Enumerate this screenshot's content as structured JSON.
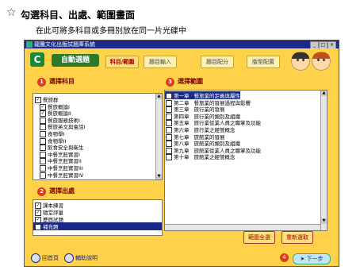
{
  "header": {
    "star": "☆",
    "title": "勾選科目、出處、範圍畫面",
    "subtitle": "在此可將多科目或多冊別放在同一片光碟中"
  },
  "window": {
    "title": "龍騰文化出版試題庫系統",
    "min_label": "_",
    "max_label": "□",
    "close_label": "×"
  },
  "toolbar": {
    "logo": "C",
    "brand": "自動選題",
    "tabs": [
      {
        "label": "科目/範圍",
        "active": true
      },
      {
        "label": "題目輸入",
        "active": false
      },
      {
        "label": "題目配分",
        "active": false
      },
      {
        "label": "版型配置",
        "active": false
      }
    ]
  },
  "subjects": {
    "number": "1",
    "heading": "選擇科目",
    "items": [
      {
        "label": "餐旅群",
        "checked": true,
        "indent": 0
      },
      {
        "label": "餐旅概論I",
        "checked": true,
        "indent": 1
      },
      {
        "label": "餐旅概論II",
        "checked": true,
        "indent": 1
      },
      {
        "label": "餐旅服務技術I",
        "checked": false,
        "indent": 1
      },
      {
        "label": "餐旅英文與會話I",
        "checked": false,
        "indent": 1
      },
      {
        "label": "食物學I",
        "checked": false,
        "indent": 1
      },
      {
        "label": "食物學II",
        "checked": false,
        "indent": 1
      },
      {
        "label": "飲食安全與衛生",
        "checked": false,
        "indent": 1
      },
      {
        "label": "中餐烹飪實習I",
        "checked": false,
        "indent": 1
      },
      {
        "label": "中餐烹飪實習II",
        "checked": false,
        "indent": 1
      },
      {
        "label": "中餐烹飪實習III",
        "checked": false,
        "indent": 1
      },
      {
        "label": "中餐烹飪實習IV",
        "checked": false,
        "indent": 1
      }
    ]
  },
  "sources": {
    "number": "2",
    "heading": "選擇出處",
    "items": [
      {
        "label": "課本練習",
        "checked": true,
        "selected": false
      },
      {
        "label": "隨堂評量",
        "checked": true,
        "selected": false
      },
      {
        "label": "歷屆試題",
        "checked": true,
        "selected": false
      },
      {
        "label": "補充題",
        "checked": true,
        "selected": true
      }
    ]
  },
  "ranges": {
    "number": "3",
    "heading": "選擇範圍",
    "items": [
      {
        "chapter": "第一章",
        "title": "餐旅業的定義與屬性",
        "checked": true,
        "selected": true
      },
      {
        "chapter": "第二章",
        "title": "餐旅業的發展過程與影響",
        "checked": false,
        "selected": false
      },
      {
        "chapter": "第三章",
        "title": "旅行業的發展",
        "checked": false,
        "selected": false
      },
      {
        "chapter": "第四章",
        "title": "旅行業的類別及組織",
        "checked": false,
        "selected": false
      },
      {
        "chapter": "第五章",
        "title": "旅行業從業人員之職掌及功能",
        "checked": false,
        "selected": false
      },
      {
        "chapter": "第六章",
        "title": "旅行業之經營概念",
        "checked": false,
        "selected": false
      },
      {
        "chapter": "第七章",
        "title": "旅館業的發展",
        "checked": false,
        "selected": false
      },
      {
        "chapter": "第八章",
        "title": "旅館業的類別及組織",
        "checked": false,
        "selected": false
      },
      {
        "chapter": "第九章",
        "title": "旅館業從業人員之職掌及功能",
        "checked": false,
        "selected": false
      },
      {
        "chapter": "第十章",
        "title": "旅館業之經營概念",
        "checked": false,
        "selected": false
      }
    ],
    "select_all_label": "範圍全選",
    "reset_label": "重新選取"
  },
  "footer": {
    "home_label": "回首頁",
    "help_label": "輔助說明",
    "step_number": "4",
    "next_label": "下一步"
  },
  "colors": {
    "window_bg": "#ffd24a",
    "titlebar": "#1a2a8a",
    "number_badge": "#e23b1a",
    "heading": "#7a0000"
  }
}
